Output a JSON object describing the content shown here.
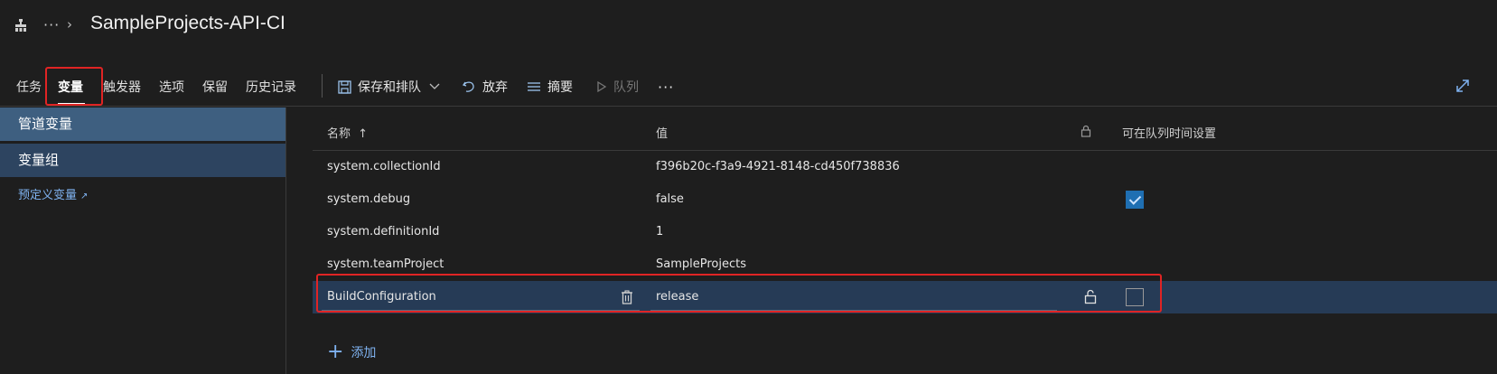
{
  "header": {
    "title": "SampleProjects-API-CI",
    "more": "···",
    "chevron": "›",
    "pipeline_icon": "pipeline-icon"
  },
  "toolbar": {
    "tabs": [
      "任务",
      "变量",
      "触发器",
      "选项",
      "保留",
      "历史记录"
    ],
    "active_tab": "变量",
    "save_queue": "保存和排队",
    "discard": "放弃",
    "summary": "摘要",
    "queue": "队列",
    "more": "···"
  },
  "sidebar": {
    "pipeline_variables": "管道变量",
    "variable_groups": "变量组",
    "predefined_variables": "预定义变量"
  },
  "grid": {
    "col_name": "名称",
    "sort_arrow": "↑",
    "col_value": "值",
    "col_settable": "可在队列时间设置",
    "rows": [
      {
        "name": "system.collectionId",
        "value": "f396b20c-f3a9-4921-8148-cd450f738836",
        "settable": null
      },
      {
        "name": "system.debug",
        "value": "false",
        "settable": true
      },
      {
        "name": "system.definitionId",
        "value": "1",
        "settable": null
      },
      {
        "name": "system.teamProject",
        "value": "SampleProjects",
        "settable": null
      },
      {
        "name": "BuildConfiguration",
        "value": "release",
        "settable": false
      }
    ],
    "add": "添加"
  },
  "colors": {
    "accent": "#1f6fb2",
    "highlight": "#e02424",
    "link": "#7fb2f0",
    "selected_row": "#263b56"
  }
}
